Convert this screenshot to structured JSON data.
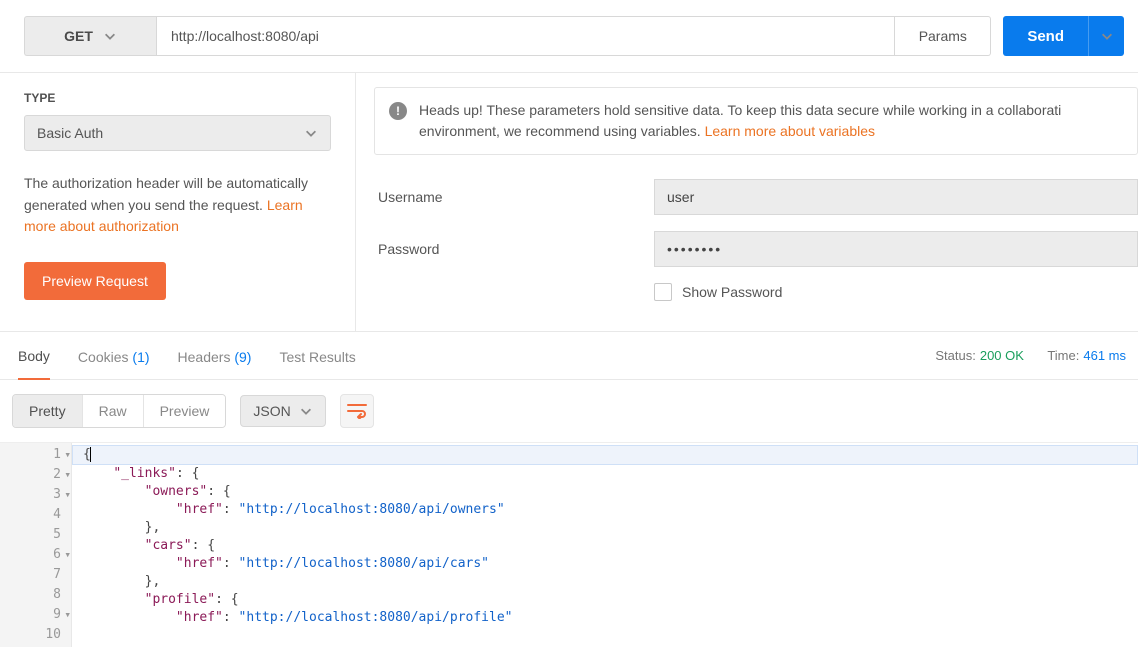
{
  "request": {
    "method": "GET",
    "url": "http://localhost:8080/api",
    "params_label": "Params",
    "send_label": "Send"
  },
  "auth": {
    "type_label": "TYPE",
    "type_value": "Basic Auth",
    "description_prefix": "The authorization header will be automatically generated when you send the request. ",
    "description_link": "Learn more about authorization",
    "preview_label": "Preview Request",
    "banner_prefix": "Heads up! These parameters hold sensitive data. To keep this data secure while working in a collaborati",
    "banner_line2_prefix": "environment, we recommend using variables. ",
    "banner_link": "Learn more about variables",
    "username_label": "Username",
    "username_value": "user",
    "password_label": "Password",
    "password_masked": "••••••••",
    "show_password_label": "Show Password"
  },
  "response": {
    "tabs": {
      "body": "Body",
      "cookies": "Cookies",
      "cookies_count": "(1)",
      "headers": "Headers",
      "headers_count": "(9)",
      "test_results": "Test Results"
    },
    "status_label": "Status:",
    "status_value": "200 OK",
    "time_label": "Time:",
    "time_value": "461 ms",
    "view_modes": {
      "pretty": "Pretty",
      "raw": "Raw",
      "preview": "Preview"
    },
    "lang": "JSON",
    "code_lines": [
      "{",
      "    \"_links\": {",
      "        \"owners\": {",
      "            \"href\": \"http://localhost:8080/api/owners\"",
      "        },",
      "        \"cars\": {",
      "            \"href\": \"http://localhost:8080/api/cars\"",
      "        },",
      "        \"profile\": {",
      "            \"href\": \"http://localhost:8080/api/profile\""
    ]
  }
}
